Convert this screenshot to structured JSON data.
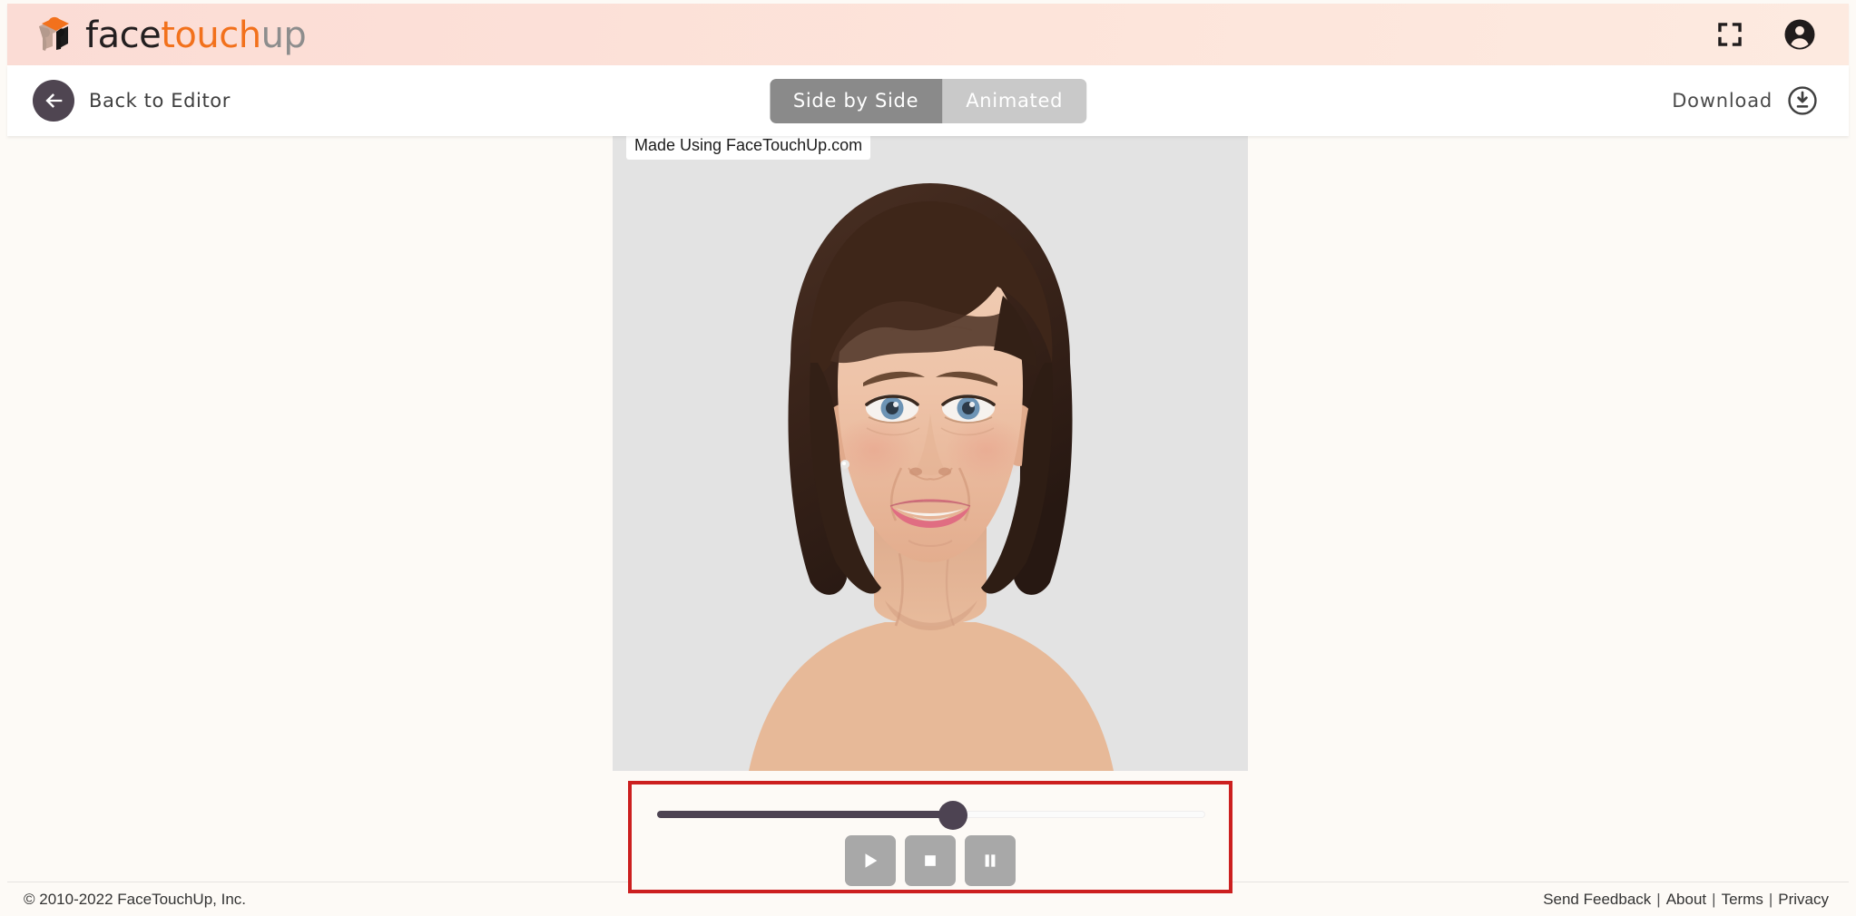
{
  "header": {
    "brand": {
      "part1": "face",
      "part2": "touch",
      "part3": "up",
      "logo_icon": "cube-logo-icon"
    },
    "fullscreen_icon": "fullscreen-icon",
    "account_icon": "account-circle-icon"
  },
  "toolbar": {
    "back_label": "Back to Editor",
    "back_icon": "arrow-left-circle-icon",
    "segments": [
      {
        "label": "Side by Side",
        "active": false
      },
      {
        "label": "Animated",
        "active": true
      }
    ],
    "download_label": "Download",
    "download_icon": "download-circle-icon"
  },
  "stage": {
    "watermark": "Made Using FaceTouchUp.com",
    "image_alt": "portrait-preview",
    "background_color": "#e3e3e3"
  },
  "player": {
    "highlight_color": "#cc1f1f",
    "progress_percent": 54,
    "track_fill_color": "#4d4352",
    "buttons": [
      {
        "name": "play-button",
        "icon": "play-icon"
      },
      {
        "name": "stop-button",
        "icon": "stop-icon"
      },
      {
        "name": "pause-button",
        "icon": "pause-icon"
      }
    ]
  },
  "footer": {
    "copyright": "© 2010-2022 FaceTouchUp, Inc.",
    "links": [
      "Send Feedback",
      "About",
      "Terms",
      "Privacy"
    ],
    "separator": "|"
  },
  "colors": {
    "header_gradient_start": "#fbdcd5",
    "header_gradient_end": "#fdeae0",
    "page_background": "#fdfaf6",
    "brand_orange": "#f2711c",
    "accent_dark": "#4f4551"
  }
}
